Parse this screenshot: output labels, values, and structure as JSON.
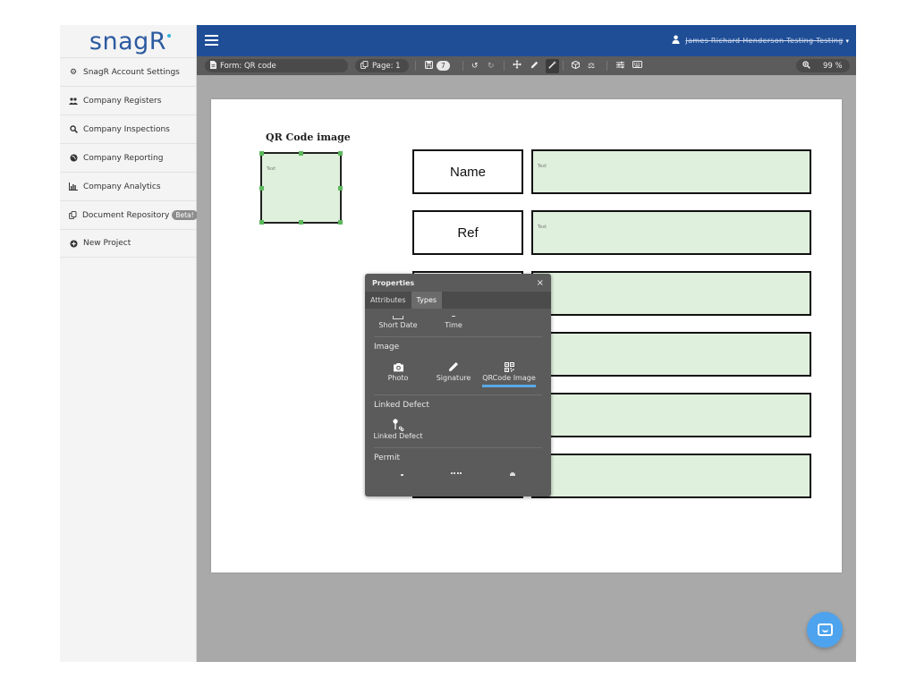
{
  "brand": {
    "logo_text": "snag",
    "logo_r": "R"
  },
  "sidebar": {
    "items": [
      {
        "label": "SnagR Account Settings",
        "icon": "cogs-icon",
        "glyph": "⚙"
      },
      {
        "label": "Company Registers",
        "icon": "users-icon",
        "glyph": "👥"
      },
      {
        "label": "Company Inspections",
        "icon": "search-icon",
        "glyph": "🔍"
      },
      {
        "label": "Company Reporting",
        "icon": "globe-icon",
        "glyph": "◍"
      },
      {
        "label": "Company Analytics",
        "icon": "bar-chart-icon",
        "glyph": "📊"
      },
      {
        "label": "Document Repository",
        "icon": "copy-icon",
        "glyph": "⧉",
        "badge": "Beta!"
      },
      {
        "label": "New Project",
        "icon": "plus-circle-icon",
        "glyph": "⊕"
      }
    ]
  },
  "topbar": {
    "user_name": "James Richard Henderson Testing Testing"
  },
  "toolbar": {
    "form_label": "Form: QR code",
    "page_label": "Page: 1",
    "save_count": "7",
    "zoom_label": "99 %"
  },
  "document": {
    "qr_title": "QR Code image",
    "placeholder": "Text",
    "rows": [
      "Name",
      "Ref",
      "",
      "",
      "",
      ""
    ]
  },
  "properties": {
    "title": "Properties",
    "close": "×",
    "tabs": [
      "Attributes",
      "Types"
    ],
    "active_tab": "Types",
    "top_types": [
      "Short Date",
      "Time"
    ],
    "sections": [
      {
        "title": "Image",
        "types": [
          {
            "label": "Photo",
            "icon": "camera-icon"
          },
          {
            "label": "Signature",
            "icon": "pencil-icon"
          },
          {
            "label": "QRCode Image",
            "icon": "qrcode-icon",
            "selected": true
          }
        ]
      },
      {
        "title": "Linked Defect",
        "types": [
          {
            "label": "Linked Defect",
            "icon": "pin-link-icon"
          }
        ]
      },
      {
        "title": "Permit",
        "types": []
      }
    ]
  },
  "colors": {
    "topbar": "#1f4e97",
    "field_fill": "#dff0dc",
    "select_accent": "#5aa9e6",
    "chat": "#4ea3ee"
  }
}
